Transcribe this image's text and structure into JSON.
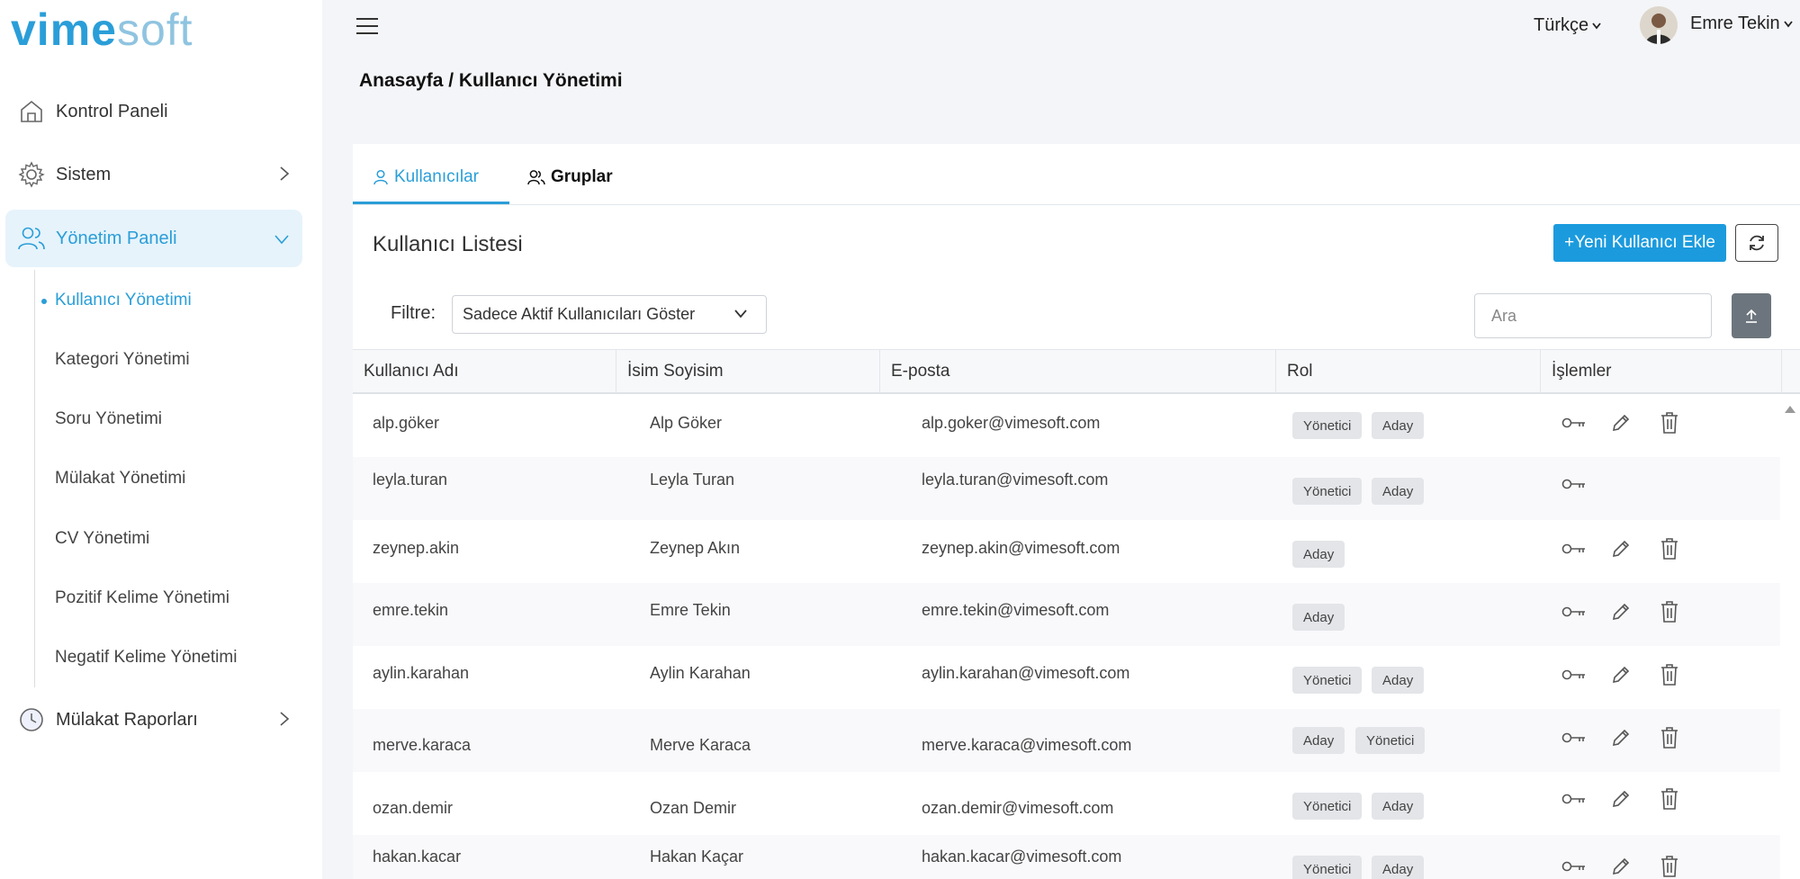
{
  "logo": {
    "part1": "vime",
    "part2": "soft"
  },
  "sidebar": {
    "items": [
      {
        "label": "Kontrol Paneli",
        "icon": "home-icon"
      },
      {
        "label": "Sistem",
        "icon": "gear-icon"
      },
      {
        "label": "Yönetim Paneli",
        "icon": "users-icon"
      },
      {
        "label": "Mülakat Raporları",
        "icon": "clock-icon"
      }
    ],
    "subitems": [
      "Kullanıcı Yönetimi",
      "Kategori Yönetimi",
      "Soru Yönetimi",
      "Mülakat Yönetimi",
      "CV Yönetimi",
      "Pozitif Kelime Yönetimi",
      "Negatif Kelime Yönetimi"
    ]
  },
  "header": {
    "language": "Türkçe",
    "user_name": "Emre Tekin",
    "breadcrumb": "Anasayfa / Kullanıcı Yönetimi"
  },
  "tabs": [
    {
      "label": "Kullanıcılar",
      "icon": "user-icon"
    },
    {
      "label": "Gruplar",
      "icon": "group-icon"
    }
  ],
  "card": {
    "title": "Kullanıcı Listesi",
    "add_button": "+Yeni Kullanıcı Ekle",
    "filter_label": "Filtre:",
    "filter_value": "Sadece Aktif Kullanıcıları Göster",
    "search_placeholder": "Ara"
  },
  "table": {
    "columns": [
      "Kullanıcı Adı",
      "İsim Soyisim",
      "E-posta",
      "Rol",
      "İşlemler"
    ],
    "rows": [
      {
        "username": "alp.göker",
        "name": "Alp Göker",
        "email": "alp.goker@vimesoft.com",
        "roles": [
          "Yönetici",
          "Aday"
        ],
        "actions": [
          "key",
          "edit",
          "delete"
        ]
      },
      {
        "username": "leyla.turan",
        "name": "Leyla Turan",
        "email": "leyla.turan@vimesoft.com",
        "roles": [
          "Yönetici",
          "Aday"
        ],
        "actions": [
          "key"
        ]
      },
      {
        "username": "zeynep.akin",
        "name": "Zeynep Akın",
        "email": "zeynep.akin@vimesoft.com",
        "roles": [
          "Aday"
        ],
        "actions": [
          "key",
          "edit",
          "delete"
        ]
      },
      {
        "username": "emre.tekin",
        "name": "Emre Tekin",
        "email": "emre.tekin@vimesoft.com",
        "roles": [
          "Aday"
        ],
        "actions": [
          "key",
          "edit",
          "delete"
        ]
      },
      {
        "username": "aylin.karahan",
        "name": "Aylin Karahan",
        "email": "aylin.karahan@vimesoft.com",
        "roles": [
          "Yönetici",
          "Aday"
        ],
        "actions": [
          "key",
          "edit",
          "delete"
        ]
      },
      {
        "username": "merve.karaca",
        "name": "Merve Karaca",
        "email": "merve.karaca@vimesoft.com",
        "roles": [
          "Aday",
          "Yönetici"
        ],
        "actions": [
          "key",
          "edit",
          "delete"
        ]
      },
      {
        "username": "ozan.demir",
        "name": "Ozan Demir",
        "email": "ozan.demir@vimesoft.com",
        "roles": [
          "Yönetici",
          "Aday"
        ],
        "actions": [
          "key",
          "edit",
          "delete"
        ]
      },
      {
        "username": "hakan.kacar",
        "name": "Hakan Kaçar",
        "email": "hakan.kacar@vimesoft.com",
        "roles": [
          "Yönetici",
          "Aday"
        ],
        "actions": [
          "key",
          "edit",
          "delete"
        ]
      }
    ]
  },
  "colors": {
    "accent": "#2a9ed8",
    "button": "#1b9bde",
    "export_button": "#6c757d"
  }
}
